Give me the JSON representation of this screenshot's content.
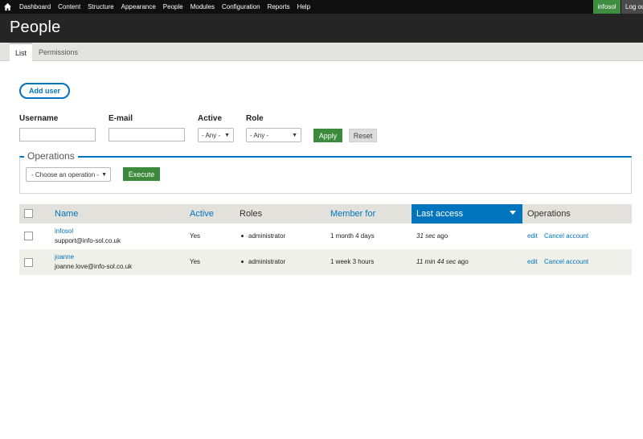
{
  "toolbar": {
    "home_icon": "home-icon",
    "menu": [
      "Dashboard",
      "Content",
      "Structure",
      "Appearance",
      "People",
      "Modules",
      "Configuration",
      "Reports",
      "Help"
    ],
    "user": "infosol",
    "logout": "Log out"
  },
  "page": {
    "title": "People"
  },
  "tabs": [
    {
      "label": "List",
      "active": true
    },
    {
      "label": "Permissions",
      "active": false
    }
  ],
  "add_user_label": "Add user",
  "filters": {
    "username_label": "Username",
    "email_label": "E-mail",
    "active_label": "Active",
    "active_value": "- Any -",
    "role_label": "Role",
    "role_value": "- Any -",
    "apply_label": "Apply",
    "reset_label": "Reset"
  },
  "operations": {
    "legend": "Operations",
    "select_value": "- Choose an operation -",
    "execute_label": "Execute"
  },
  "table": {
    "columns": {
      "name": "Name",
      "active": "Active",
      "roles": "Roles",
      "member_for": "Member for",
      "last_access": "Last access",
      "operations": "Operations"
    },
    "rows": [
      {
        "name": "infosol",
        "email": "support@info-sol.co.uk",
        "active": "Yes",
        "role": "administrator",
        "member_for": "1 month 4 days",
        "last_access_em": "31 sec",
        "last_access_suffix": " ago",
        "edit": "edit",
        "cancel": "Cancel account"
      },
      {
        "name": "joanne",
        "email": "joanne.love@info-sol.co.uk",
        "active": "Yes",
        "role": "administrator",
        "member_for": "1 week 3 hours",
        "last_access_em": "11 min 44 sec",
        "last_access_suffix": " ago",
        "edit": "edit",
        "cancel": "Cancel account"
      }
    ]
  },
  "colors": {
    "accent": "#0074bd",
    "button_green": "#3c8a3c",
    "toolbar": "#0f0f0f",
    "header": "#252525"
  }
}
